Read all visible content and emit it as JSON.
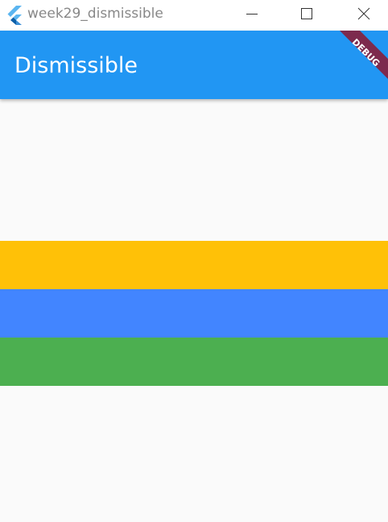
{
  "window": {
    "title": "week29_dismissible",
    "controls": {
      "minimize_icon": "minimize-icon",
      "maximize_icon": "maximize-icon",
      "close_icon": "close-icon"
    },
    "app_icon": "flutter-logo-icon"
  },
  "appbar": {
    "title": "Dismissible",
    "color": "#2196f3",
    "debug_banner": "DEBUG",
    "debug_banner_color": "#7d2a4d"
  },
  "items": [
    {
      "color": "#ffc107"
    },
    {
      "color": "#4285ff"
    },
    {
      "color": "#4caf50"
    }
  ],
  "background": "#fafafa"
}
